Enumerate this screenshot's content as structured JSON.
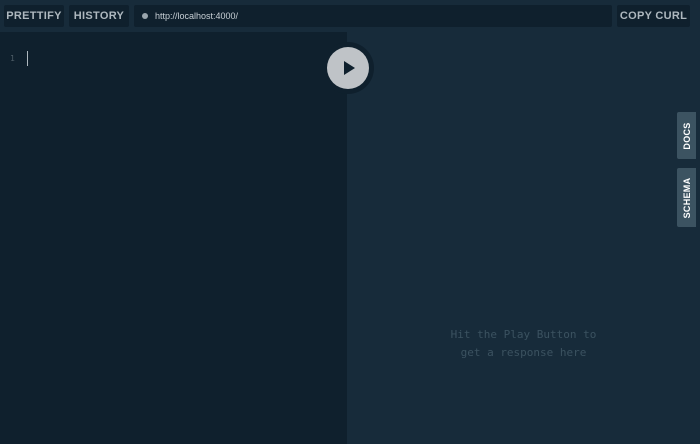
{
  "toolbar": {
    "prettify_label": "PRETTIFY",
    "history_label": "HISTORY",
    "endpoint_url": "http://localhost:4000/",
    "copy_curl_label": "COPY CURL"
  },
  "editor": {
    "line_number": "1"
  },
  "result": {
    "placeholder_line1": "Hit the Play Button to",
    "placeholder_line2": "get a response here"
  },
  "side_tabs": {
    "docs_label": "DOCS",
    "schema_label": "SCHEMA"
  },
  "icons": {
    "play": "play-icon",
    "status": "status-dot-icon"
  },
  "colors": {
    "editor_bg": "#0f202d",
    "result_bg": "#172b3a",
    "tab_bg": "#3c5361",
    "play_button": "#bfc3c7"
  }
}
